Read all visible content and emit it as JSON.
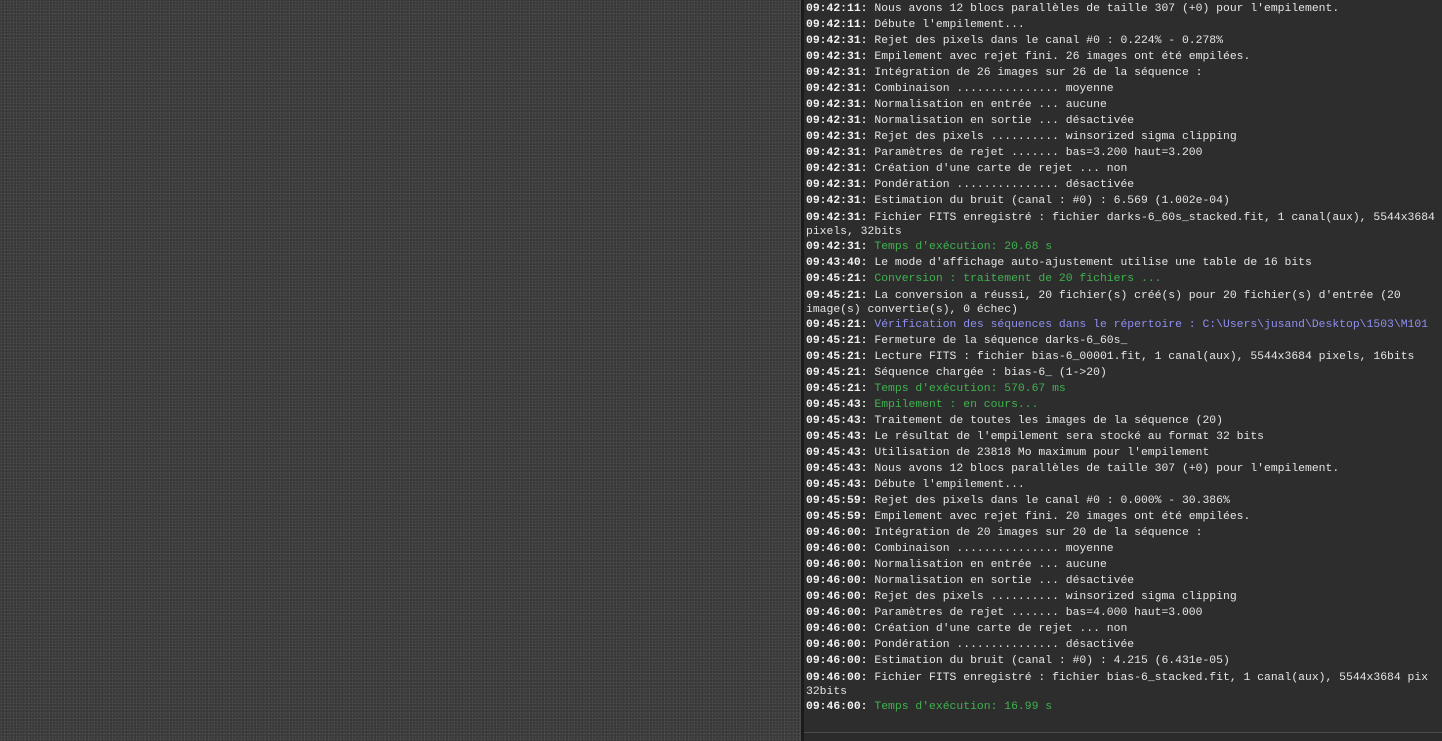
{
  "console": {
    "lines": [
      {
        "time": "09:42:11:",
        "text": " Nous avons 12 blocs parallèles de taille 307 (+0) pour l'empilement.",
        "style": "normal"
      },
      {
        "time": "09:42:11:",
        "text": " Débute l'empilement...",
        "style": "normal"
      },
      {
        "time": "09:42:31:",
        "text": " Rejet des pixels dans le canal #0 : 0.224% - 0.278%",
        "style": "normal"
      },
      {
        "time": "09:42:31:",
        "text": " Empilement avec rejet fini. 26 images ont été empilées.",
        "style": "normal"
      },
      {
        "time": "09:42:31:",
        "text": " Intégration de 26 images sur 26 de la séquence :",
        "style": "normal"
      },
      {
        "time": "09:42:31:",
        "text": " Combinaison ............... moyenne",
        "style": "normal"
      },
      {
        "time": "09:42:31:",
        "text": " Normalisation en entrée ... aucune",
        "style": "normal"
      },
      {
        "time": "09:42:31:",
        "text": " Normalisation en sortie ... désactivée",
        "style": "normal"
      },
      {
        "time": "09:42:31:",
        "text": " Rejet des pixels .......... winsorized sigma clipping",
        "style": "normal"
      },
      {
        "time": "09:42:31:",
        "text": " Paramètres de rejet ....... bas=3.200 haut=3.200",
        "style": "normal"
      },
      {
        "time": "09:42:31:",
        "text": " Création d'une carte de rejet ... non",
        "style": "normal"
      },
      {
        "time": "09:42:31:",
        "text": " Pondération ............... désactivée",
        "style": "normal"
      },
      {
        "time": "09:42:31:",
        "text": " Estimation du bruit (canal : #0) : 6.569 (1.002e-04)",
        "style": "normal"
      },
      {
        "time": "09:42:31:",
        "text": " Fichier FITS enregistré : fichier darks-6_60s_stacked.fit, 1 canal(aux), 5544x3684\npixels, 32bits",
        "style": "normal",
        "wrap": true
      },
      {
        "time": "09:42:31:",
        "text": " Temps d'exécution: 20.68 s",
        "style": "green"
      },
      {
        "time": "09:43:40:",
        "text": " Le mode d'affichage auto-ajustement utilise une table de 16 bits",
        "style": "normal"
      },
      {
        "time": "09:45:21:",
        "text": " Conversion : traitement de 20 fichiers ...",
        "style": "green"
      },
      {
        "time": "09:45:21:",
        "text": " La conversion a réussi, 20 fichier(s) créé(s) pour 20 fichier(s) d'entrée (20\nimage(s) convertie(s), 0 échec)",
        "style": "normal",
        "wrap": true
      },
      {
        "time": "09:45:21:",
        "text": " Vérification des séquences dans le répertoire : C:\\Users\\jusand\\Desktop\\1503\\M101",
        "style": "blue"
      },
      {
        "time": "09:45:21:",
        "text": " Fermeture de la séquence darks-6_60s_",
        "style": "normal"
      },
      {
        "time": "09:45:21:",
        "text": " Lecture FITS : fichier bias-6_00001.fit, 1 canal(aux), 5544x3684 pixels, 16bits",
        "style": "normal"
      },
      {
        "time": "09:45:21:",
        "text": " Séquence chargée : bias-6_ (1->20)",
        "style": "normal"
      },
      {
        "time": "09:45:21:",
        "text": " Temps d'exécution: 570.67 ms",
        "style": "green"
      },
      {
        "time": "09:45:43:",
        "text": " Empilement : en cours...",
        "style": "green"
      },
      {
        "time": "09:45:43:",
        "text": " Traitement de toutes les images de la séquence (20)",
        "style": "normal"
      },
      {
        "time": "09:45:43:",
        "text": " Le résultat de l'empilement sera stocké au format 32 bits",
        "style": "normal"
      },
      {
        "time": "09:45:43:",
        "text": " Utilisation de 23818 Mo maximum pour l'empilement",
        "style": "normal"
      },
      {
        "time": "09:45:43:",
        "text": " Nous avons 12 blocs parallèles de taille 307 (+0) pour l'empilement.",
        "style": "normal"
      },
      {
        "time": "09:45:43:",
        "text": " Débute l'empilement...",
        "style": "normal"
      },
      {
        "time": "09:45:59:",
        "text": " Rejet des pixels dans le canal #0 : 0.000% - 30.386%",
        "style": "normal"
      },
      {
        "time": "09:45:59:",
        "text": " Empilement avec rejet fini. 20 images ont été empilées.",
        "style": "normal"
      },
      {
        "time": "09:46:00:",
        "text": " Intégration de 20 images sur 20 de la séquence :",
        "style": "normal"
      },
      {
        "time": "09:46:00:",
        "text": " Combinaison ............... moyenne",
        "style": "normal"
      },
      {
        "time": "09:46:00:",
        "text": " Normalisation en entrée ... aucune",
        "style": "normal"
      },
      {
        "time": "09:46:00:",
        "text": " Normalisation en sortie ... désactivée",
        "style": "normal"
      },
      {
        "time": "09:46:00:",
        "text": " Rejet des pixels .......... winsorized sigma clipping",
        "style": "normal"
      },
      {
        "time": "09:46:00:",
        "text": " Paramètres de rejet ....... bas=4.000 haut=3.000",
        "style": "normal"
      },
      {
        "time": "09:46:00:",
        "text": " Création d'une carte de rejet ... non",
        "style": "normal"
      },
      {
        "time": "09:46:00:",
        "text": " Pondération ............... désactivée",
        "style": "normal"
      },
      {
        "time": "09:46:00:",
        "text": " Estimation du bruit (canal : #0) : 4.215 (6.431e-05)",
        "style": "normal"
      },
      {
        "time": "09:46:00:",
        "text": " Fichier FITS enregistré : fichier bias-6_stacked.fit, 1 canal(aux), 5544x3684 pix\n32bits",
        "style": "normal",
        "wrap": true
      },
      {
        "time": "09:46:00:",
        "text": " Temps d'exécution: 16.99 s",
        "style": "green"
      }
    ]
  },
  "colors": {
    "normal_text": "#e6e6e6",
    "success_text": "#3fb34f",
    "info_text": "#8f8ff2",
    "console_bg": "#2d2d2d",
    "image_bg": "#3c3c3c"
  }
}
